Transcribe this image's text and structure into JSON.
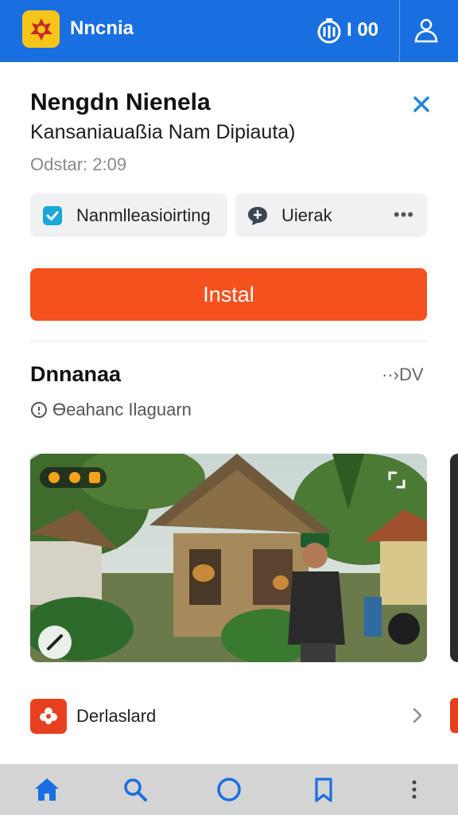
{
  "header": {
    "app_title": "Nncnia",
    "timer_text": "I 00",
    "logo_icon": "emblem-icon",
    "timer_icon": "stopwatch-icon",
    "profile_icon": "person-icon",
    "brand_color": "#1a6fe0"
  },
  "sheet": {
    "title": "Nengdn Nienela",
    "subtitle": "Kansaniauaßia Nam Dipiauta)",
    "meta": "Odstar: 2:09",
    "close_icon": "close-icon",
    "chips": [
      {
        "label": "Nanmlleasioirting",
        "icon": "check-square-icon"
      },
      {
        "label": "Uierak",
        "icon": "speech-bubble-icon",
        "more": "•••"
      }
    ],
    "install_label": "Instal",
    "install_color": "#f4511e"
  },
  "section": {
    "title": "Dnnanaa",
    "more": "··›DV",
    "subtitle": "Ɵeahanc Ilaguarn",
    "subtitle_icon": "info-icon"
  },
  "media": {
    "description_icon": "photo-thumbnail",
    "badge_icon": "sound-badge-icon",
    "tool_icon": "brush-icon",
    "corner_icon": "expand-icon"
  },
  "list": {
    "label": "Derlaslard",
    "icon": "flower-icon",
    "chevron_icon": "chevron-right-icon"
  },
  "bottom_nav": [
    {
      "name": "home-icon"
    },
    {
      "name": "search-icon"
    },
    {
      "name": "circle-icon"
    },
    {
      "name": "bookmark-icon"
    },
    {
      "name": "more-vertical-icon"
    }
  ]
}
